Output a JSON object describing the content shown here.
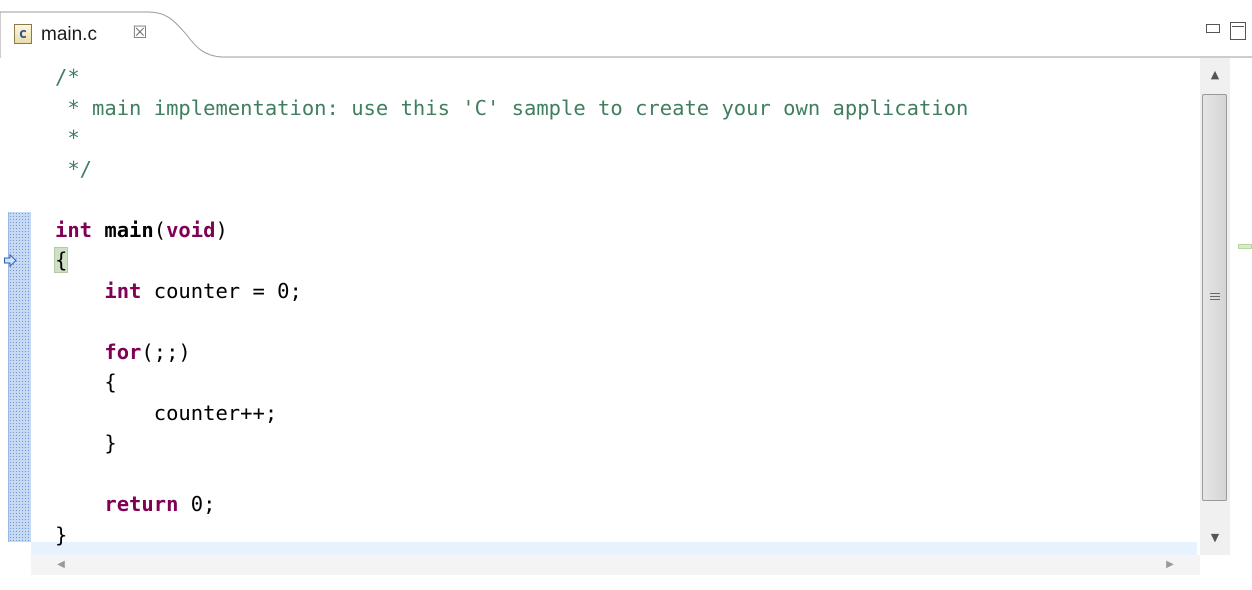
{
  "tab": {
    "file_icon": "c-source-file-icon",
    "icon_glyph": "c",
    "title": "main.c",
    "close_glyph": "☒"
  },
  "window_controls": {
    "minimize_icon": "minimize-icon",
    "maximize_icon": "maximize-icon"
  },
  "editor": {
    "language": "C",
    "current_line": 7,
    "lines": [
      [
        {
          "t": "/*",
          "c": "cm"
        }
      ],
      [
        {
          "t": " * main implementation: use this 'C' sample to create your own application",
          "c": "cm"
        }
      ],
      [
        {
          "t": " *",
          "c": "cm"
        }
      ],
      [
        {
          "t": " */",
          "c": "cm"
        }
      ],
      [],
      [
        {
          "t": "int",
          "c": "kw"
        },
        {
          "t": " "
        },
        {
          "t": "main",
          "c": "fn"
        },
        {
          "t": "("
        },
        {
          "t": "void",
          "c": "kw"
        },
        {
          "t": ")"
        }
      ],
      [
        {
          "t": "{",
          "c": "brace-hl"
        }
      ],
      [
        {
          "t": "    "
        },
        {
          "t": "int",
          "c": "kw"
        },
        {
          "t": " counter = 0;"
        }
      ],
      [],
      [
        {
          "t": "    "
        },
        {
          "t": "for",
          "c": "kw"
        },
        {
          "t": "(;;)"
        }
      ],
      [
        {
          "t": "    {"
        }
      ],
      [
        {
          "t": "        counter++;"
        }
      ],
      [
        {
          "t": "    }"
        }
      ],
      [],
      [
        {
          "t": "    "
        },
        {
          "t": "return",
          "c": "kw"
        },
        {
          "t": " 0;"
        }
      ],
      [
        {
          "t": "}"
        }
      ]
    ]
  },
  "icons": {
    "instruction_pointer": "instruction-pointer-arrow-icon",
    "scroll_up": "scroll-up-arrow-icon",
    "scroll_down": "scroll-down-arrow-icon",
    "scroll_left": "scroll-left-arrow-icon",
    "scroll_right": "scroll-right-arrow-icon",
    "thumb_grip": "scrollbar-grip-icon"
  },
  "colors": {
    "comment": "#3f7f5f",
    "keyword": "#7f0055",
    "current_line": "#e8f2fe",
    "brace_match": "#cfe0c4"
  }
}
